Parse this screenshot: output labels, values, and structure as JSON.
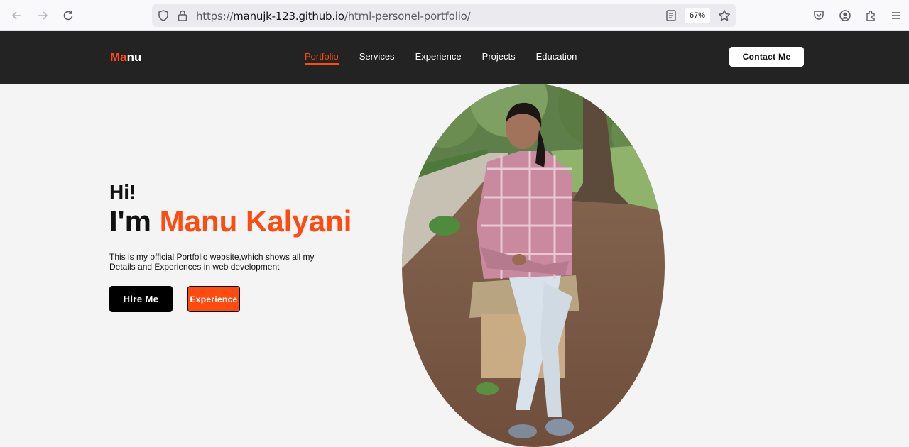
{
  "browser": {
    "url_scheme": "https://",
    "url_host": "manujk-123.github.io",
    "url_path": "/html-personel-portfolio/",
    "zoom": "67%"
  },
  "site": {
    "logo_accent": "Ma",
    "logo_rest": "nu",
    "nav": [
      {
        "label": "Portfolio",
        "active": true
      },
      {
        "label": "Services"
      },
      {
        "label": "Experience"
      },
      {
        "label": "Projects"
      },
      {
        "label": "Education"
      }
    ],
    "contact_label": "Contact Me"
  },
  "hero": {
    "greeting": "Hi!",
    "intro": "I'm ",
    "name": "Manu Kalyani",
    "description": "This is my official Portfolio website,which shows all my Details and Experiences in web development",
    "hire_label": "Hire Me",
    "experience_label": "Experience"
  },
  "colors": {
    "accent": "#ff4b0f",
    "header_bg": "#232323",
    "page_bg": "#f4f4f4"
  }
}
